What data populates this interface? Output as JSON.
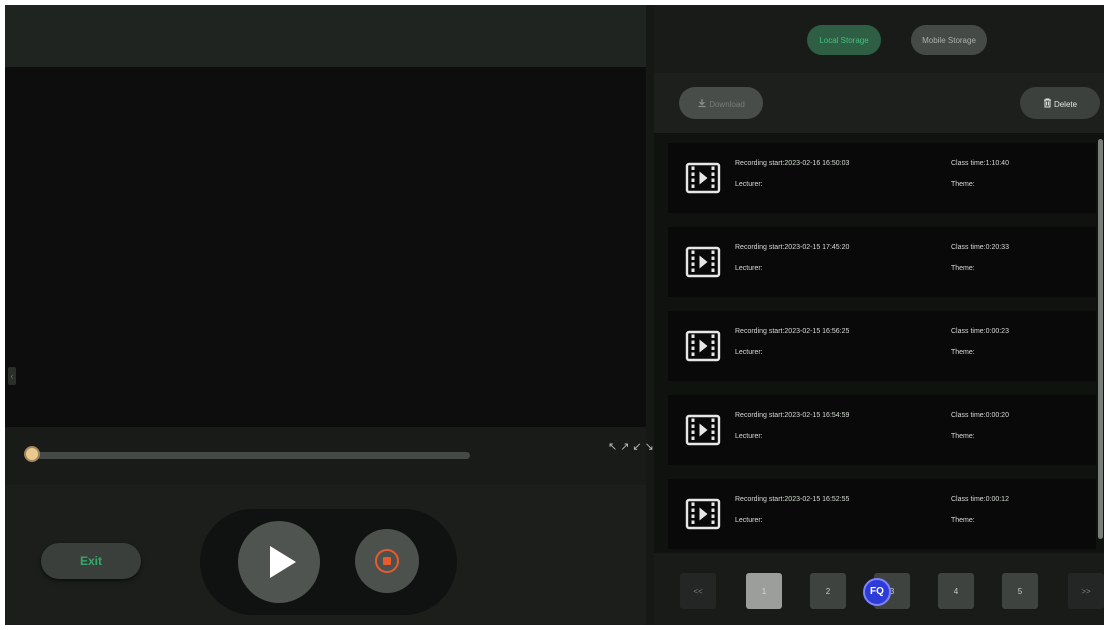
{
  "player": {
    "side_handle": "‹",
    "progress": 0.0,
    "fullscreen_glyph": "↖↗↙↘",
    "exit_label": "Exit"
  },
  "storage": {
    "tabs": [
      {
        "label": "Local Storage",
        "active": true
      },
      {
        "label": "Mobile Storage",
        "active": false
      }
    ],
    "download_label": "Download",
    "delete_label": "Delete",
    "recordings": [
      {
        "start": "Recording start:2023-02-16 16:50:03",
        "lecturer": "Lecturer:",
        "class_time": "Class time:1:10:40",
        "theme": "Theme:"
      },
      {
        "start": "Recording start:2023-02-15 17:45:20",
        "lecturer": "Lecturer:",
        "class_time": "Class time:0:20:33",
        "theme": "Theme:"
      },
      {
        "start": "Recording start:2023-02-15 16:56:25",
        "lecturer": "Lecturer:",
        "class_time": "Class time:0:00:23",
        "theme": "Theme:"
      },
      {
        "start": "Recording start:2023-02-15 16:54:59",
        "lecturer": "Lecturer:",
        "class_time": "Class time:0:00:20",
        "theme": "Theme:"
      },
      {
        "start": "Recording start:2023-02-15 16:52:55",
        "lecturer": "Lecturer:",
        "class_time": "Class time:0:00:12",
        "theme": "Theme:"
      }
    ],
    "pagination": {
      "prev": "<<",
      "pages": [
        "1",
        "2",
        "3",
        "4",
        "5"
      ],
      "current": "1",
      "next": ">>",
      "badge": "FQ"
    }
  },
  "colors": {
    "accent_green": "#44c07c",
    "stop_red": "#ea5a2d",
    "badge_blue": "#2d3bd8"
  },
  "icons": [
    "video-file-icon",
    "download-icon",
    "trash-icon",
    "play-icon",
    "stop-icon",
    "fullscreen-icon"
  ]
}
